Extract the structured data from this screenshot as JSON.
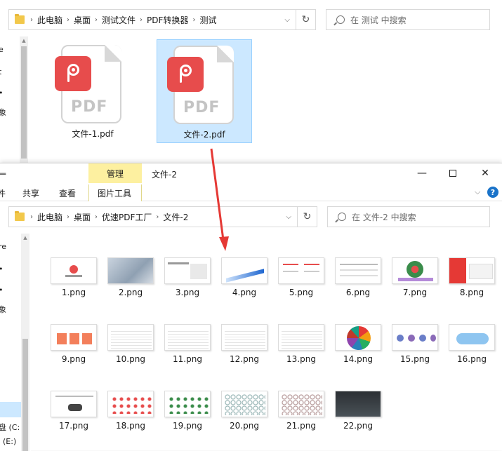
{
  "top_window": {
    "breadcrumb": [
      "此电脑",
      "桌面",
      "测试文件",
      "PDF转换器",
      "测试"
    ],
    "search_placeholder": "在 测试 中搜索",
    "sidebar_fragments": [
      "e",
      "t",
      "•",
      "象"
    ],
    "files": [
      {
        "name": "文件-1.pdf",
        "selected": false
      },
      {
        "name": "文件-2.pdf",
        "selected": true
      }
    ],
    "pdf_label": "PDF"
  },
  "bottom_window": {
    "context_tab_header": "管理",
    "title": "文件-2",
    "ribbon_tabs": [
      "件",
      "共享",
      "查看",
      "图片工具"
    ],
    "breadcrumb": [
      "此电脑",
      "桌面",
      "优速PDF工厂",
      "文件-2"
    ],
    "search_placeholder": "在 文件-2 中搜索",
    "nav_fragments": [
      "re",
      "•",
      "•",
      "象"
    ],
    "drives": [
      "盘 (C:",
      "(E:)"
    ],
    "images": [
      "1.png",
      "2.png",
      "3.png",
      "4.png",
      "5.png",
      "6.png",
      "7.png",
      "8.png",
      "9.png",
      "10.png",
      "11.png",
      "12.png",
      "13.png",
      "14.png",
      "15.png",
      "16.png",
      "17.png",
      "18.png",
      "19.png",
      "20.png",
      "21.png",
      "22.png"
    ]
  },
  "colors": {
    "selection": "#cce8ff",
    "context_tab": "#fdf0a0",
    "arrow": "#e53935",
    "pdf_badge": "#e74c4c"
  },
  "icons": [
    "folder-icon",
    "chevron-right-icon",
    "chevron-down-icon",
    "refresh-icon",
    "search-icon",
    "minimize-icon",
    "maximize-icon",
    "close-icon",
    "help-icon",
    "pdf-file-icon",
    "red-arrow"
  ]
}
